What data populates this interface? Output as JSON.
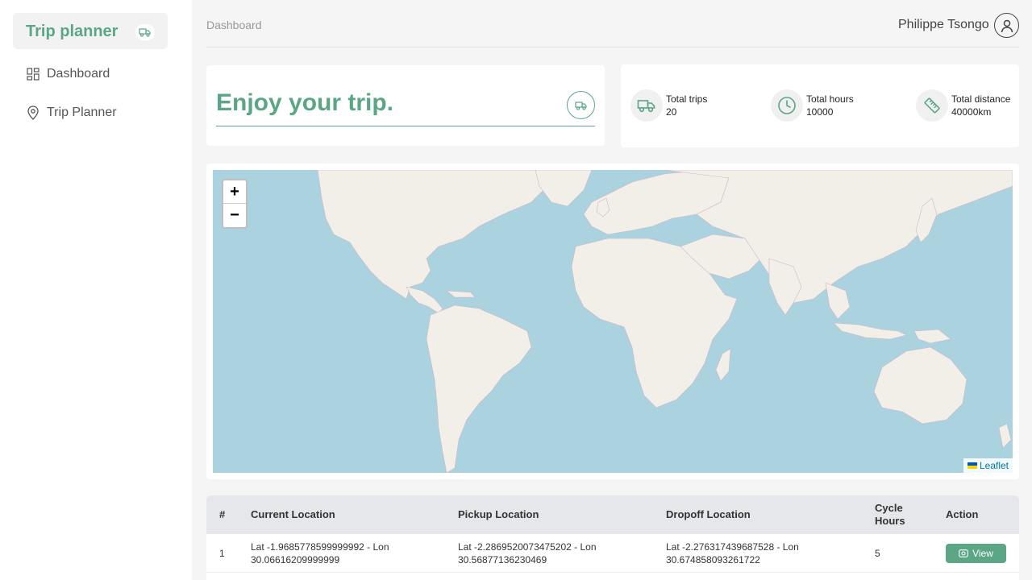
{
  "sidebar": {
    "brand": "Trip planner",
    "items": [
      {
        "label": "Dashboard",
        "icon": "dashboard-grid-icon"
      },
      {
        "label": "Trip Planner",
        "icon": "map-pin-icon"
      }
    ]
  },
  "header": {
    "breadcrumb": "Dashboard",
    "user_name": "Philippe Tsongo"
  },
  "hero": {
    "title": "Enjoy your trip."
  },
  "stats": [
    {
      "label": "Total trips",
      "value": "20",
      "icon": "truck-icon"
    },
    {
      "label": "Total hours",
      "value": "10000",
      "icon": "clock-icon"
    },
    {
      "label": "Total distance",
      "value": "40000km",
      "icon": "ruler-icon"
    }
  ],
  "map": {
    "zoom_in": "+",
    "zoom_out": "−",
    "attribution": "Leaflet"
  },
  "table": {
    "headers": {
      "index": "#",
      "current": "Current Location",
      "pickup": "Pickup Location",
      "dropoff": "Dropoff Location",
      "cycle_line1": "Cycle",
      "cycle_line2": "Hours",
      "action": "Action"
    },
    "rows": [
      {
        "index": "1",
        "current_l1": "Lat -1.9685778599999992 - Lon",
        "current_l2": "30.06616209999999",
        "pickup_l1": "Lat -2.2869520073475202 - Lon",
        "pickup_l2": "30.56877136230469",
        "dropoff_l1": "Lat -2.276317439687528 - Lon",
        "dropoff_l2": "30.674858093261722",
        "cycle": "5",
        "action": "View"
      }
    ]
  },
  "colors": {
    "accent": "#5aa685",
    "ocean": "#aad3df",
    "land": "#f2efe9"
  }
}
